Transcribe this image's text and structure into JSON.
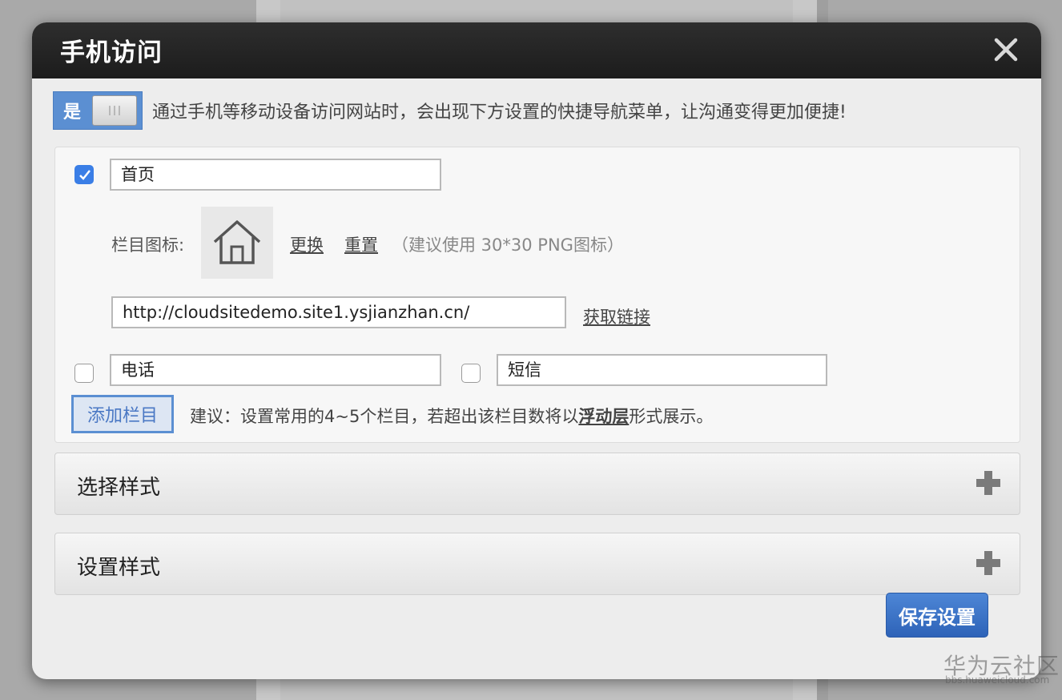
{
  "dialog": {
    "title": "手机访问"
  },
  "toggle": {
    "label": "是",
    "description": "通过手机等移动设备访问网站时，会出现下方设置的快捷导航菜单，让沟通变得更加便捷!"
  },
  "nav_items": [
    {
      "name": "首页",
      "checked": true
    },
    {
      "name": "电话",
      "checked": false
    },
    {
      "name": "短信",
      "checked": false
    }
  ],
  "icon_settings": {
    "label": "栏目图标:",
    "change_link": "更换",
    "reset_link": "重置",
    "hint": "（建议使用 30*30 PNG图标）"
  },
  "link_settings": {
    "url": "http://cloudsitedemo.site1.ysjianzhan.cn/",
    "get_link": "获取链接"
  },
  "add_section": {
    "button": "添加栏目",
    "suggest_prefix": "建议：设置常用的4~5个栏目，若超出该栏目数将以",
    "suggest_link": "浮动层",
    "suggest_suffix": "形式展示。"
  },
  "accordions": [
    {
      "title": "选择样式"
    },
    {
      "title": "设置样式"
    }
  ],
  "save_button": "保存设置",
  "watermark": {
    "text": "华为云社区",
    "sub": "bbs.huaweicloud.com"
  }
}
